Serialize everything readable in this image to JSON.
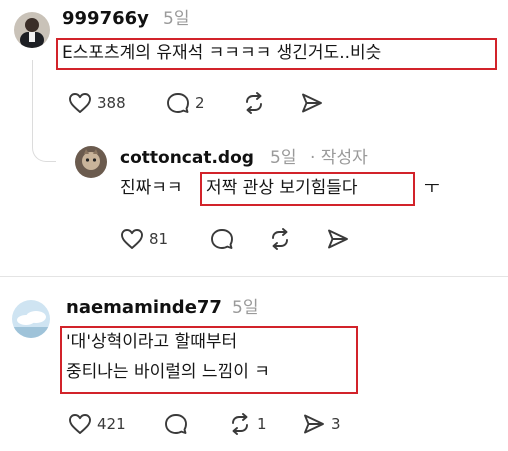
{
  "comment1": {
    "username": "999766y",
    "time": "5일",
    "text": "E스포츠계의 유재석 ㅋㅋㅋㅋ 생긴거도..비슷",
    "likes": "388",
    "replies": "2",
    "reposts": "",
    "shares": ""
  },
  "reply1": {
    "username": "cottoncat.dog",
    "time": "5일",
    "author_badge": "· 작성자",
    "text_plain": "진짜ㅋㅋ",
    "text_boxed": "저짝 관상 보기힘들다",
    "text_tail": "ㅜ",
    "likes": "81",
    "replies": "",
    "reposts": "",
    "shares": ""
  },
  "comment2": {
    "username": "naemaminde77",
    "time": "5일",
    "text_line1": "'대'상혁이라고 할때부터",
    "text_line2": "중티나는 바이럴의 느낌이 ㅋ",
    "likes": "421",
    "replies": "",
    "reposts": "1",
    "shares": "3"
  },
  "colors": {
    "highlight": "#d2232a",
    "muted": "#9a9a9a",
    "icon": "#3a3a3a"
  },
  "icons": [
    "heart-icon",
    "comment-icon",
    "repost-icon",
    "share-icon"
  ]
}
